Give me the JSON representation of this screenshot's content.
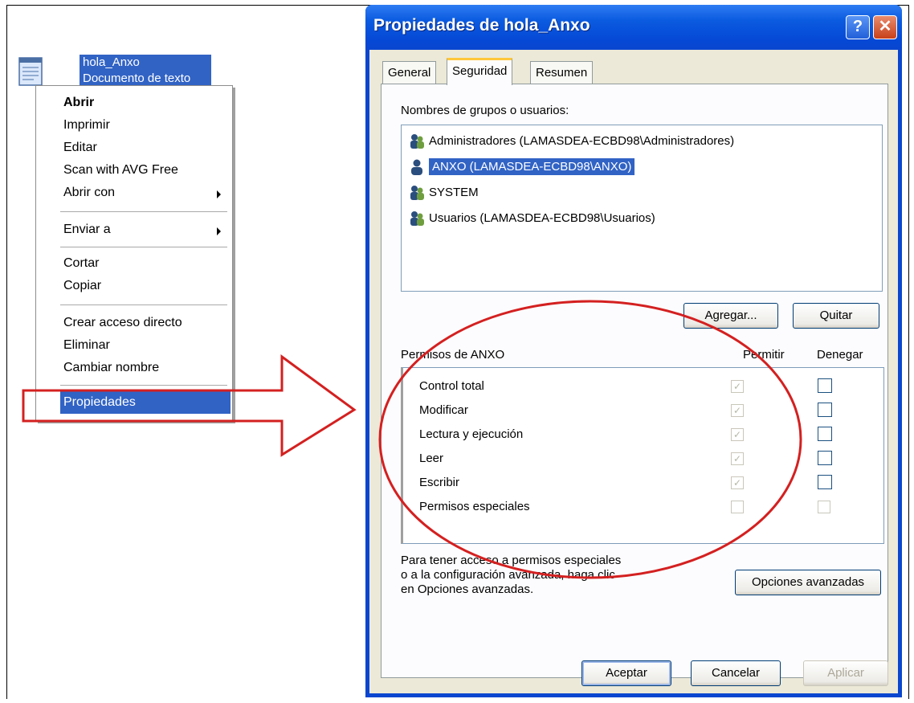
{
  "desktop": {
    "file_label_line1": "hola_Anxo",
    "file_label_line2": "Documento de texto"
  },
  "context_menu": {
    "items": [
      {
        "label": "Abrir"
      },
      {
        "label": "Imprimir"
      },
      {
        "label": "Editar"
      },
      {
        "label": "Scan with AVG Free"
      },
      {
        "label": "Abrir con"
      },
      {
        "label": "Enviar a"
      },
      {
        "label": "Cortar"
      },
      {
        "label": "Copiar"
      },
      {
        "label": "Crear acceso directo"
      },
      {
        "label": "Eliminar"
      },
      {
        "label": "Cambiar nombre"
      },
      {
        "label": "Propiedades"
      }
    ]
  },
  "dialog": {
    "title": "Propiedades de hola_Anxo",
    "help_glyph": "?",
    "close_glyph": "✕",
    "tabs": [
      {
        "label": "General"
      },
      {
        "label": "Seguridad"
      },
      {
        "label": "Resumen"
      }
    ],
    "groups_label": "Nombres de grupos o usuarios:",
    "users": [
      {
        "label": "Administradores (LAMASDEA-ECBD98\\Administradores)"
      },
      {
        "label": "ANXO (LAMASDEA-ECBD98\\ANXO)"
      },
      {
        "label": "SYSTEM"
      },
      {
        "label": "Usuarios (LAMASDEA-ECBD98\\Usuarios)"
      }
    ],
    "add_button": "Agregar...",
    "remove_button": "Quitar",
    "permissions_label": "Permisos de ANXO",
    "allow_header": "Permitir",
    "deny_header": "Denegar",
    "permissions": [
      {
        "label": "Control total",
        "allow": true,
        "deny": false
      },
      {
        "label": "Modificar",
        "allow": true,
        "deny": false
      },
      {
        "label": "Lectura y ejecución",
        "allow": true,
        "deny": false
      },
      {
        "label": "Leer",
        "allow": true,
        "deny": false
      },
      {
        "label": "Escribir",
        "allow": true,
        "deny": false
      },
      {
        "label": "Permisos especiales",
        "allow": false,
        "deny": false
      }
    ],
    "info_line1": "Para tener acceso a permisos especiales",
    "info_line2": "o a la configuración avanzada, haga clic",
    "info_line3": "en Opciones avanzadas.",
    "advanced_button": "Opciones avanzadas",
    "ok_button": "Aceptar",
    "cancel_button": "Cancelar",
    "apply_button": "Aplicar",
    "check_glyph": "✓"
  },
  "colors": {
    "selection": "#3163c5",
    "title_bar": "#0a46cf",
    "annotation": "#d42020"
  }
}
